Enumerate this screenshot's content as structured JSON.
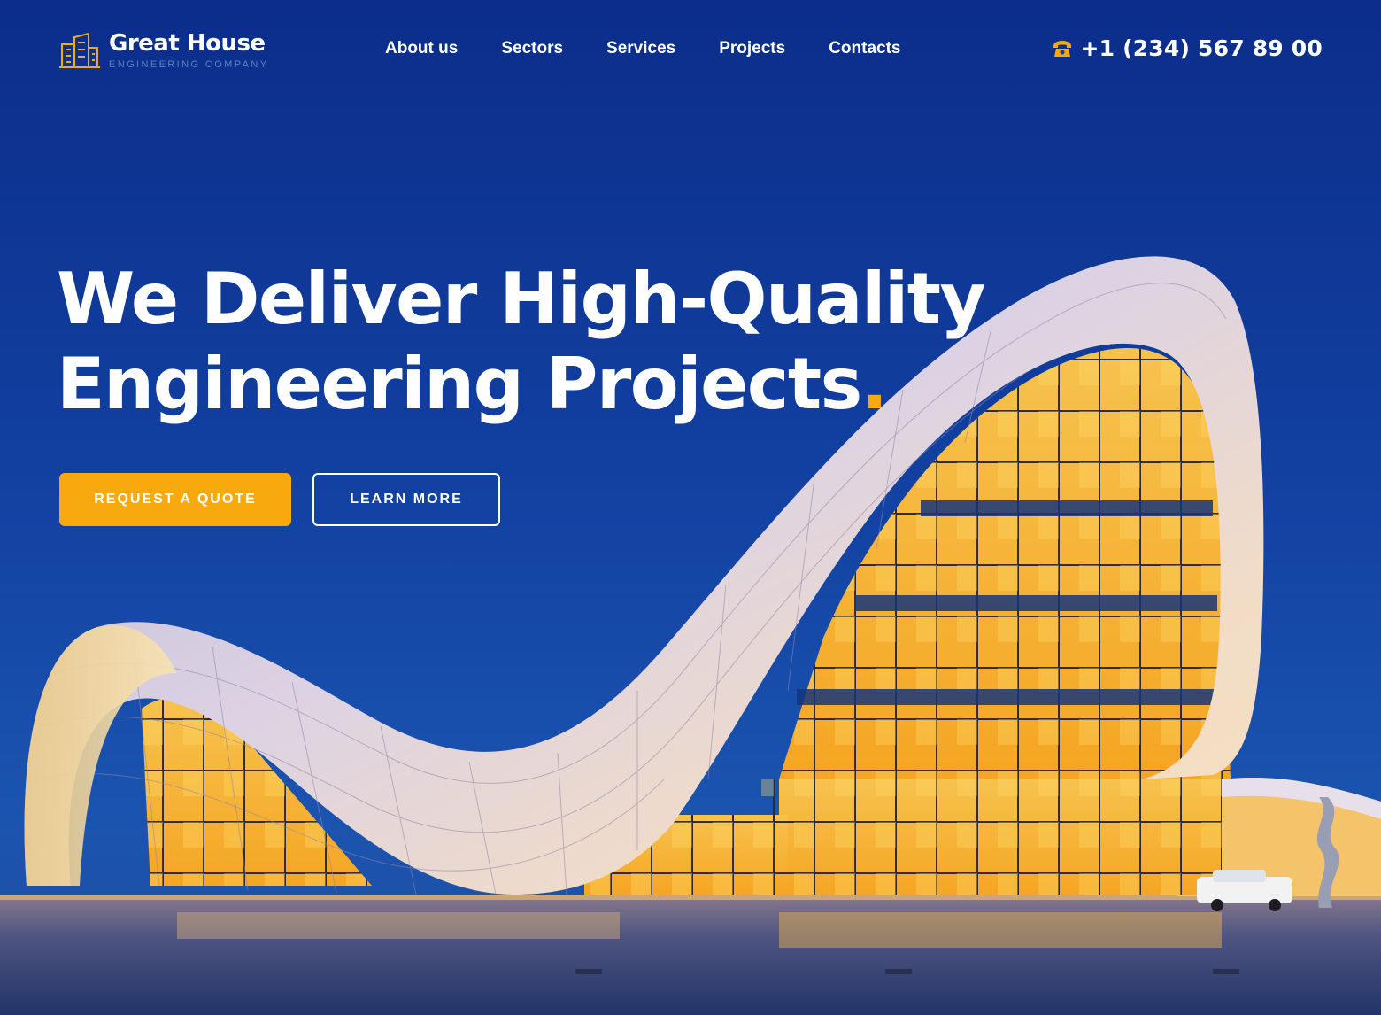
{
  "brand": {
    "name": "Great House",
    "tagline": "ENGINEERING COMPANY",
    "logo_icon": "building-logo-icon"
  },
  "nav": {
    "items": [
      {
        "label": "About us"
      },
      {
        "label": "Sectors"
      },
      {
        "label": "Services"
      },
      {
        "label": "Projects"
      },
      {
        "label": "Contacts"
      }
    ]
  },
  "contact": {
    "phone_icon": "phone-icon",
    "phone": "+1 (234) 567 89 00"
  },
  "hero": {
    "headline_line1": "We Deliver High-Quality",
    "headline_line2": "Engineering Projects",
    "headline_accent": ".",
    "primary_button": "REQUEST A QUOTE",
    "secondary_button": "LEARN MORE",
    "background_image": "futuristic curved-roof building illuminated at dusk"
  },
  "colors": {
    "accent": "#f7a90e",
    "background": "#0f3596",
    "text": "#ffffff"
  }
}
